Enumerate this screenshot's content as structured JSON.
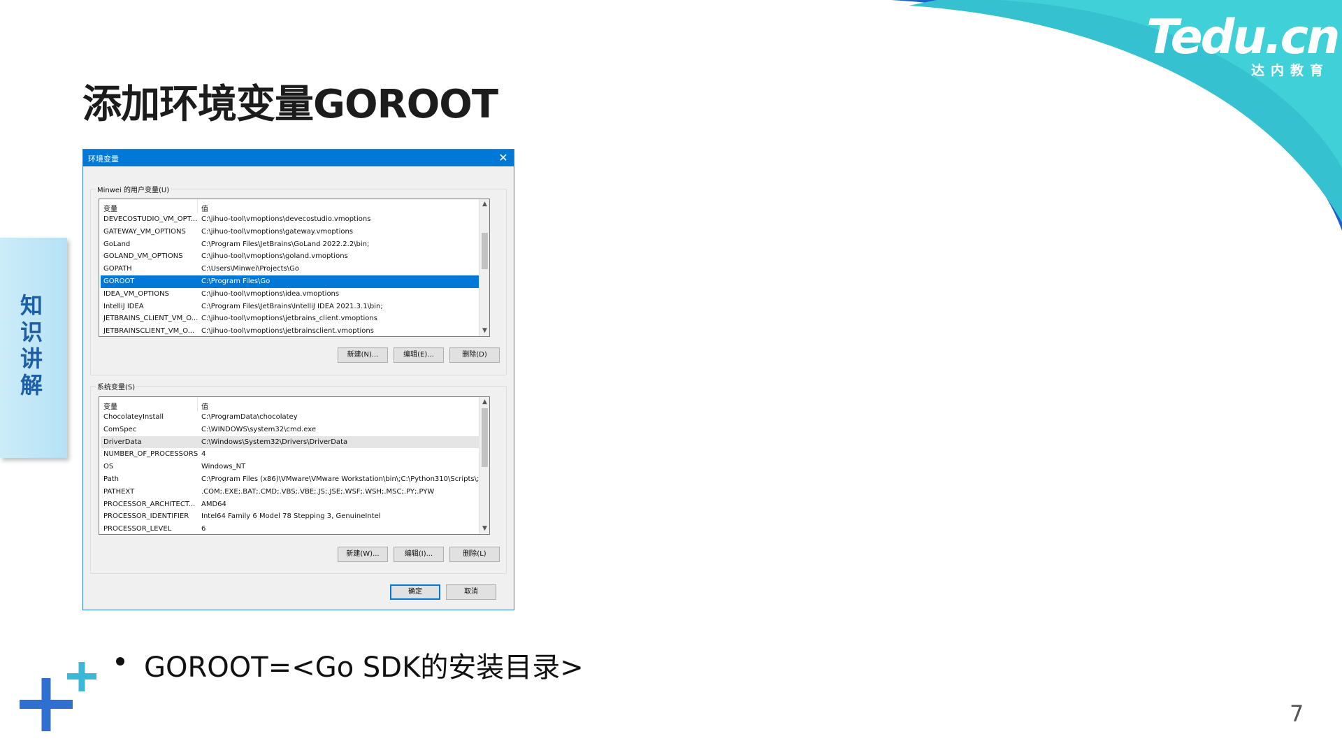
{
  "logo": {
    "main": "Tedu.cn",
    "sub": "达内教育"
  },
  "slide": {
    "title": "添加环境变量GOROOT",
    "side_tab": "知识讲解",
    "bullet": "GOROOT=<Go SDK的安装目录>",
    "page_number": "7"
  },
  "dialog": {
    "title": "环境变量",
    "user_group_label": "Minwei 的用户变量(U)",
    "system_group_label": "系统变量(S)",
    "col_var": "变量",
    "col_val": "值",
    "user_vars": [
      {
        "name": "DEVECOSTUDIO_VM_OPT...",
        "value": "C:\\jihuo-tool\\vmoptions\\devecostudio.vmoptions"
      },
      {
        "name": "GATEWAY_VM_OPTIONS",
        "value": "C:\\jihuo-tool\\vmoptions\\gateway.vmoptions"
      },
      {
        "name": "GoLand",
        "value": "C:\\Program Files\\JetBrains\\GoLand 2022.2.2\\bin;"
      },
      {
        "name": "GOLAND_VM_OPTIONS",
        "value": "C:\\jihuo-tool\\vmoptions\\goland.vmoptions"
      },
      {
        "name": "GOPATH",
        "value": "C:\\Users\\Minwei\\Projects\\Go"
      },
      {
        "name": "GOROOT",
        "value": "C:\\Program Files\\Go"
      },
      {
        "name": "IDEA_VM_OPTIONS",
        "value": "C:\\jihuo-tool\\vmoptions\\idea.vmoptions"
      },
      {
        "name": "IntelliJ IDEA",
        "value": "C:\\Program Files\\JetBrains\\IntelliJ IDEA 2021.3.1\\bin;"
      },
      {
        "name": "JETBRAINS_CLIENT_VM_O...",
        "value": "C:\\jihuo-tool\\vmoptions\\jetbrains_client.vmoptions"
      },
      {
        "name": "JETBRAINSCLIENT_VM_O...",
        "value": "C:\\jihuo-tool\\vmoptions\\jetbrainsclient.vmoptions"
      }
    ],
    "user_selected_index": 5,
    "system_vars": [
      {
        "name": "ChocolateyInstall",
        "value": "C:\\ProgramData\\chocolatey"
      },
      {
        "name": "ComSpec",
        "value": "C:\\WINDOWS\\system32\\cmd.exe"
      },
      {
        "name": "DriverData",
        "value": "C:\\Windows\\System32\\Drivers\\DriverData"
      },
      {
        "name": "NUMBER_OF_PROCESSORS",
        "value": "4"
      },
      {
        "name": "OS",
        "value": "Windows_NT"
      },
      {
        "name": "Path",
        "value": "C:\\Program Files (x86)\\VMware\\VMware Workstation\\bin\\;C:\\Python310\\Scripts\\;..."
      },
      {
        "name": "PATHEXT",
        "value": ".COM;.EXE;.BAT;.CMD;.VBS;.VBE;.JS;.JSE;.WSF;.WSH;.MSC;.PY;.PYW"
      },
      {
        "name": "PROCESSOR_ARCHITECT...",
        "value": "AMD64"
      },
      {
        "name": "PROCESSOR_IDENTIFIER",
        "value": "Intel64 Family 6 Model 78 Stepping 3, GenuineIntel"
      },
      {
        "name": "PROCESSOR_LEVEL",
        "value": "6"
      }
    ],
    "system_hover_index": 2,
    "user_buttons": {
      "new": "新建(N)...",
      "edit": "编辑(E)...",
      "delete": "删除(D)"
    },
    "system_buttons": {
      "new": "新建(W)...",
      "edit": "编辑(I)...",
      "delete": "删除(L)"
    },
    "ok": "确定",
    "cancel": "取消"
  },
  "colors": {
    "accent": "#0078d7",
    "wave_dark": "#1b61c9",
    "wave_teal": "#35c1cf",
    "side_tab_text": "#1c5ea8",
    "plus_blue": "#2e6fd0",
    "plus_teal": "#3bb8d8"
  }
}
